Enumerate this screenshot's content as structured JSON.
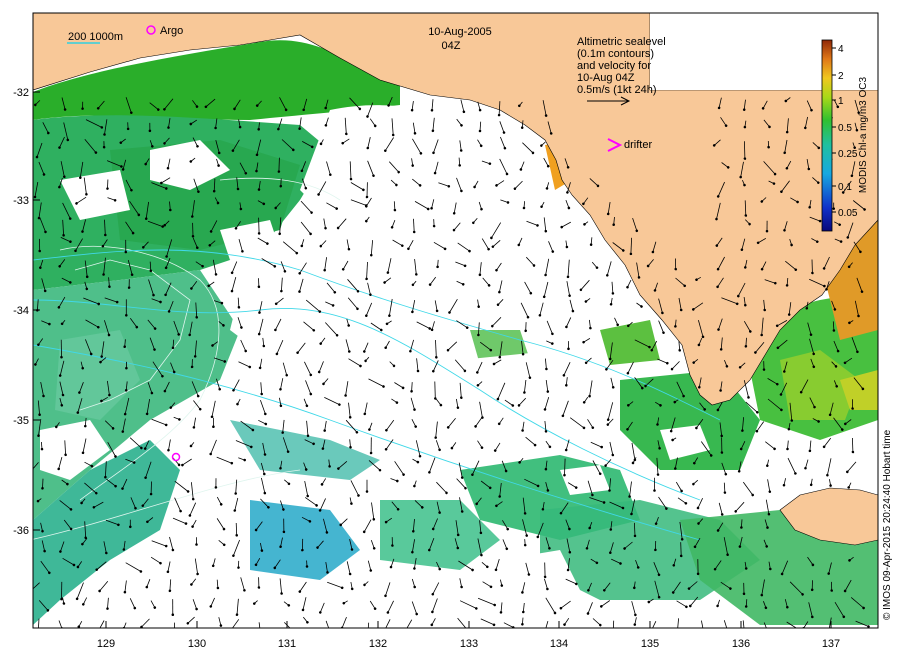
{
  "header": {
    "date": "10-Aug-2005",
    "time": "04Z"
  },
  "legend": {
    "depth_label": "200 1000m",
    "argo_label": "Argo",
    "drifter_label": "drifter",
    "note_lines": [
      "Altimetric sealevel",
      "(0.1m contours)",
      "and velocity for",
      "10-Aug 04Z",
      "0.5m/s (1kt 24h)"
    ]
  },
  "colorbar": {
    "title": "MODIS Chl-a mg/m3 OC3",
    "ticks": [
      "4",
      "2",
      "1",
      "0.5",
      "0.25",
      "0.1",
      "0.05"
    ]
  },
  "credit": "© IMOS 09-Apr-2015 20:24:40 Hobart time",
  "axes": {
    "lat_ticks": [
      "-32",
      "-33",
      "-34",
      "-35",
      "-36"
    ],
    "lon_ticks": [
      "129",
      "130",
      "131",
      "132",
      "133",
      "134",
      "135",
      "136",
      "137"
    ]
  },
  "markers": {
    "argo_floats": [
      {
        "lon": 129.8,
        "lat": -35.35
      }
    ]
  },
  "colors": {
    "land": "#f8c898",
    "chl_high": "#1faa1f",
    "chl_mid": "#4fc08a",
    "chl_low": "#22a8c8",
    "argo": "#ff00ff",
    "drifter": "#ff00ff"
  }
}
